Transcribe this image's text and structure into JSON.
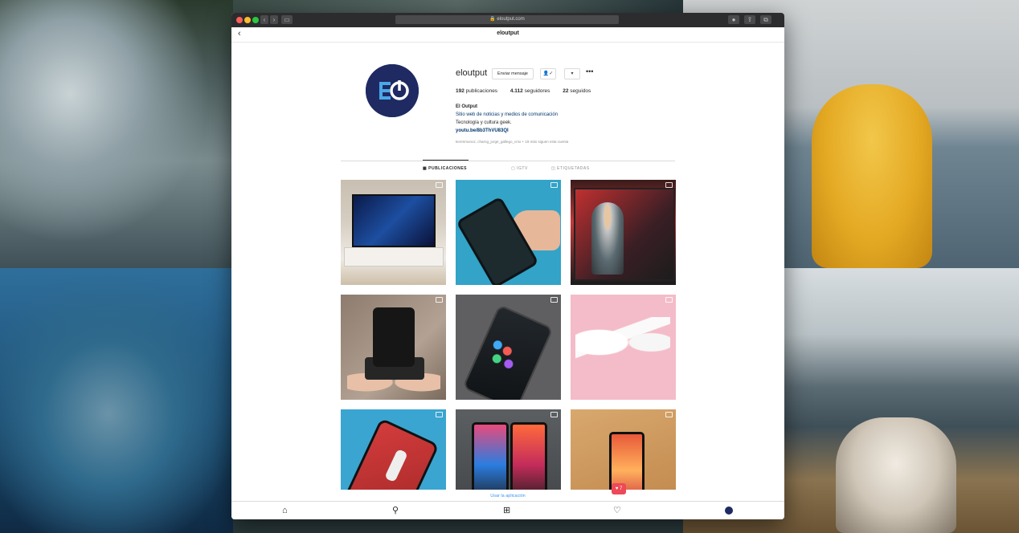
{
  "browser": {
    "url": "eloutput.com"
  },
  "instagram": {
    "nav_title": "eloutput",
    "profile": {
      "username": "eloutput",
      "message_button": "Enviar mensaje",
      "follow_icon_label": "👤✓",
      "dropdown_icon": "▾",
      "more_icon": "•••",
      "stats": {
        "posts_count": "192",
        "posts_label": "publicaciones",
        "followers_count": "4.112",
        "followers_label": "seguidores",
        "following_count": "22",
        "following_label": "seguidos"
      },
      "bio": {
        "name": "El Output",
        "line1": "Sitio web de noticias y medios de comunicación",
        "line2": "Tecnología y cultura geek.",
        "link": "youtu.be/8b3ThVU83QI"
      },
      "followed_by": "kerenmunoz, charng_jorge_gallego_cmx + 19 más siguen esta cuenta"
    },
    "tabs": [
      {
        "label": "PUBLICACIONES",
        "active": true
      },
      {
        "label": "IGTV",
        "active": false
      },
      {
        "label": "ETIQUETADAS",
        "active": false
      }
    ],
    "posts": [
      {
        "subject": "tv-on-stand",
        "type": "video"
      },
      {
        "subject": "hand-holding-phone",
        "type": "video"
      },
      {
        "subject": "laptop-person",
        "type": "album"
      },
      {
        "subject": "hands-with-camera",
        "type": "video"
      },
      {
        "subject": "phone-on-grey",
        "type": "video"
      },
      {
        "subject": "earbuds-on-pink",
        "type": "video"
      },
      {
        "subject": "red-phone",
        "type": "video"
      },
      {
        "subject": "two-phones",
        "type": "video"
      },
      {
        "subject": "phone-on-orange",
        "type": "video"
      }
    ],
    "use_app_link": "Usar la aplicación",
    "notification_count": "7",
    "bottom_nav": [
      "home-icon",
      "search-icon",
      "new-post-icon",
      "activity-icon",
      "profile-icon"
    ]
  },
  "colors": {
    "brand_blue": "#1f2a63",
    "link_blue": "#3897f0",
    "notification_red": "#ed4956"
  }
}
